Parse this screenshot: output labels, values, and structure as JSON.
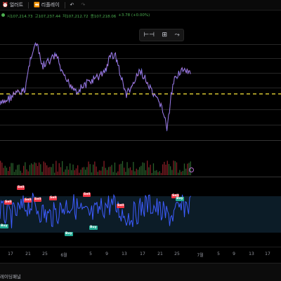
{
  "toolbar": {
    "alert_label": "얼러트",
    "replay_label": "리플레이",
    "alert_icon": "alarm-clock-icon",
    "replay_icon": "rewind-icon",
    "undo_icon": "undo-icon",
    "redo_icon": "redo-icon"
  },
  "legend": {
    "open": "시107,214.73",
    "high": "고107,237.44",
    "low": "저107,212.72",
    "close": "종107,218.06",
    "change": "+3.78 (+0.00%)"
  },
  "chart_tools": [
    "range-tool-icon",
    "grid-tool-icon",
    "trend-tool-icon"
  ],
  "x_axis": {
    "ticks": [
      "17",
      "21",
      "25",
      "6월",
      "5",
      "9",
      "13",
      "17",
      "21",
      "25",
      "7월",
      "5",
      "9",
      "13",
      "17"
    ]
  },
  "signals": [
    {
      "type": "sell",
      "label": "Sell"
    },
    {
      "type": "sell",
      "label": "Sell"
    },
    {
      "type": "sell",
      "label": "Sell"
    },
    {
      "type": "sell",
      "label": "Sell"
    },
    {
      "type": "sell",
      "label": "Sell"
    },
    {
      "type": "sell",
      "label": "Sell"
    },
    {
      "type": "sell",
      "label": "Sell"
    },
    {
      "type": "sell",
      "label": "Sell"
    },
    {
      "type": "buy",
      "label": "Buy"
    },
    {
      "type": "buy",
      "label": "Buy"
    },
    {
      "type": "buy",
      "label": "Buy"
    },
    {
      "type": "buy",
      "label": "Buy"
    }
  ],
  "bottom_panel": {
    "label": "레이딩패널"
  },
  "colors": {
    "price_line": "#b97ad9",
    "price_line_alt": "#6f7dff",
    "osc_line": "#3d5cff",
    "dashed_level": "#ffeb3b",
    "up": "#4caf50",
    "down": "#f23645"
  }
}
